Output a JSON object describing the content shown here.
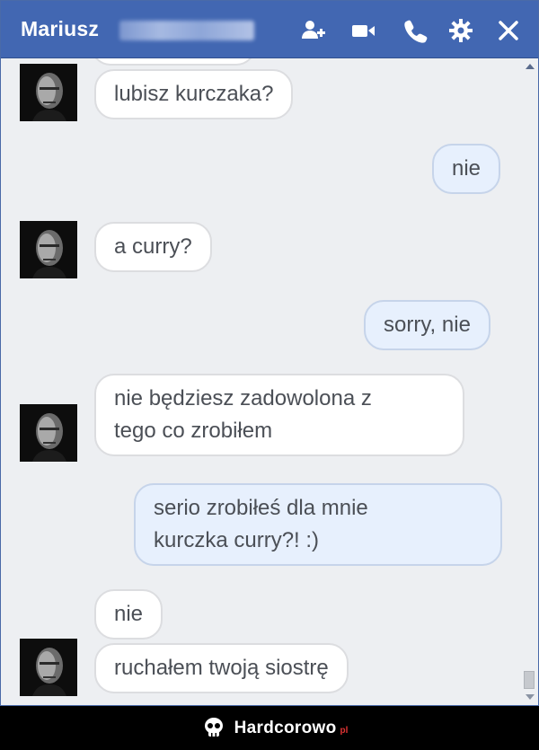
{
  "header": {
    "contact_name": "Mariusz",
    "icons": [
      "add-person-icon",
      "video-camera-icon",
      "phone-icon",
      "gear-icon",
      "close-icon"
    ],
    "bg_color": "#4267b2"
  },
  "messages": [
    {
      "side": "in",
      "text": "lubisz kurczaka?"
    },
    {
      "side": "out",
      "text": "nie"
    },
    {
      "side": "in",
      "text": "a curry?"
    },
    {
      "side": "out",
      "text": "sorry, nie"
    },
    {
      "side": "in",
      "text": "nie będziesz zadowolona z\ntego co zrobiłem"
    },
    {
      "side": "out",
      "text": "serio zrobiłeś dla mnie\nkurczka curry?! :)"
    },
    {
      "side": "in",
      "text": "nie"
    },
    {
      "side": "in",
      "text": "ruchałem twoją siostrę"
    }
  ],
  "watermark": {
    "brand": "Hardcorowo",
    "tld": "pl"
  },
  "colors": {
    "incoming_bubble": "#ffffff",
    "outgoing_bubble": "#e7f0fd",
    "chat_background": "#edeff2"
  }
}
